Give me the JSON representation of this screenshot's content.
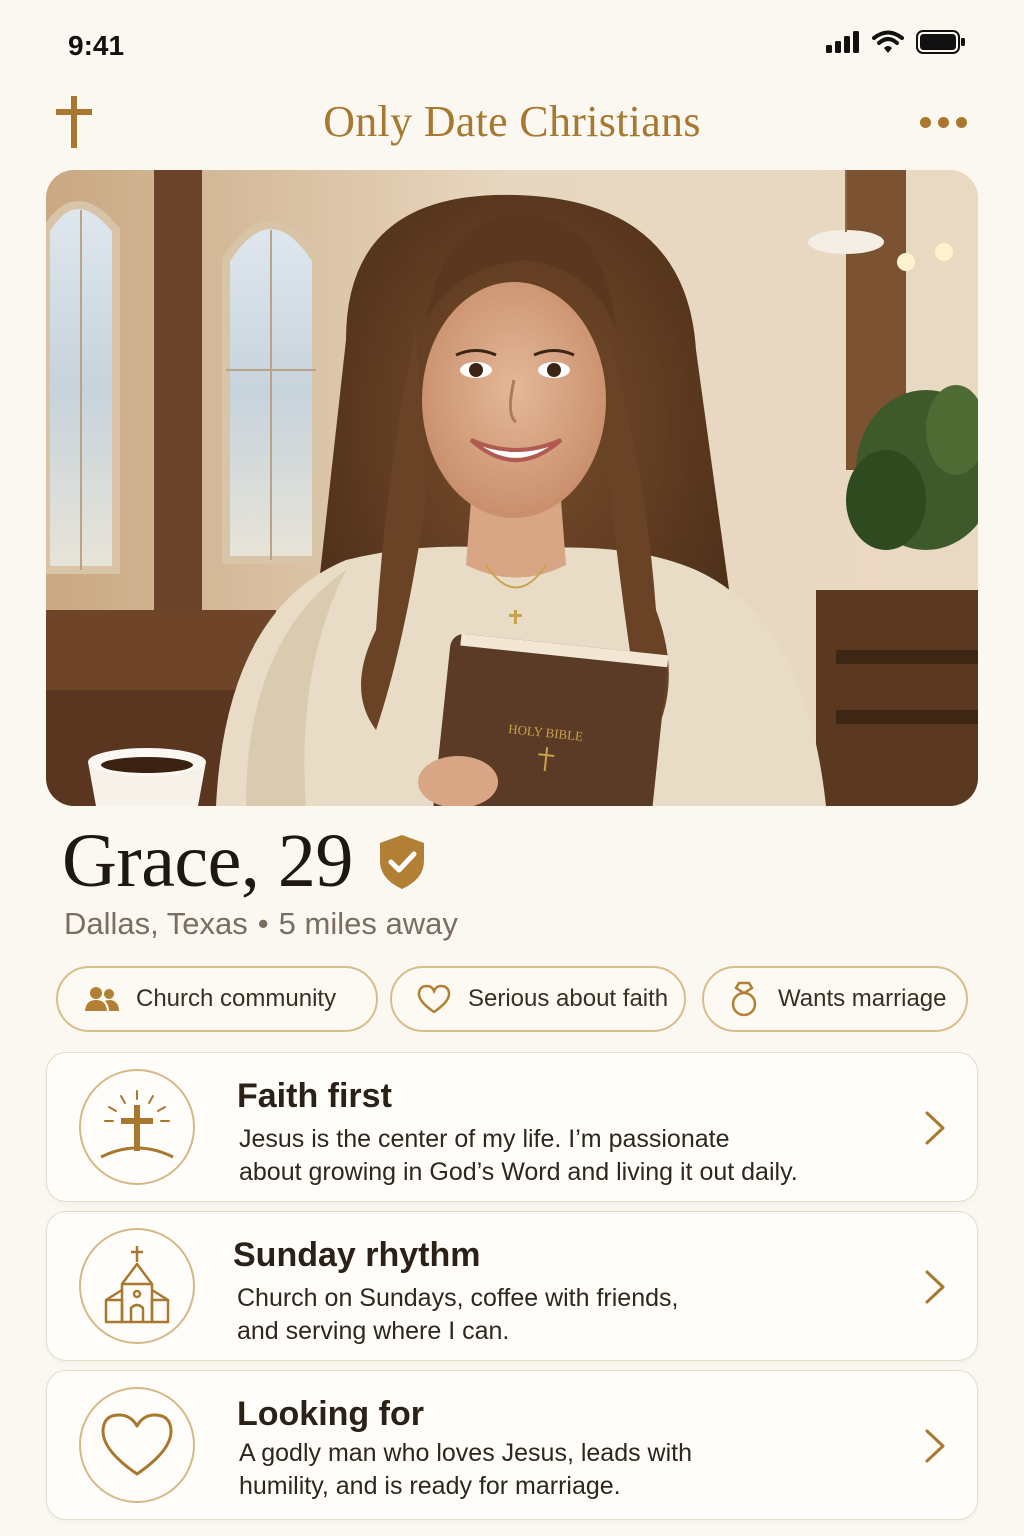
{
  "status_bar": {
    "time": "9:41"
  },
  "header": {
    "title": "Only Date Christians"
  },
  "profile": {
    "name_age": "Grace, 29",
    "location": "Dallas, Texas",
    "distance": "5 miles away",
    "verified_icon": "verified-shield-icon"
  },
  "chips": [
    {
      "label": "Church community",
      "icon": "people-icon"
    },
    {
      "label": "Serious about faith",
      "icon": "heart-outline-icon"
    },
    {
      "label": "Wants marriage",
      "icon": "ring-icon"
    }
  ],
  "cards": [
    {
      "title": "Faith first",
      "desc_line1": "Jesus is the center of my life. I’m passionate",
      "desc_line2": "about growing in God’s Word and living it out daily.",
      "icon": "cross-sunrise-icon"
    },
    {
      "title": "Sunday rhythm",
      "desc_line1": "Church on Sundays, coffee with friends,",
      "desc_line2": "and serving where I can.",
      "icon": "church-icon"
    },
    {
      "title": "Looking for",
      "desc_line1": "A godly man who loves Jesus, leads with",
      "desc_line2": "humility, and is ready for marriage.",
      "icon": "heart-icon"
    }
  ],
  "photo": {
    "bible_text": "HOLY BIBLE"
  },
  "colors": {
    "accent": "#a8782f",
    "background": "#fbf8f2",
    "chip_border": "#d9bd8d"
  }
}
